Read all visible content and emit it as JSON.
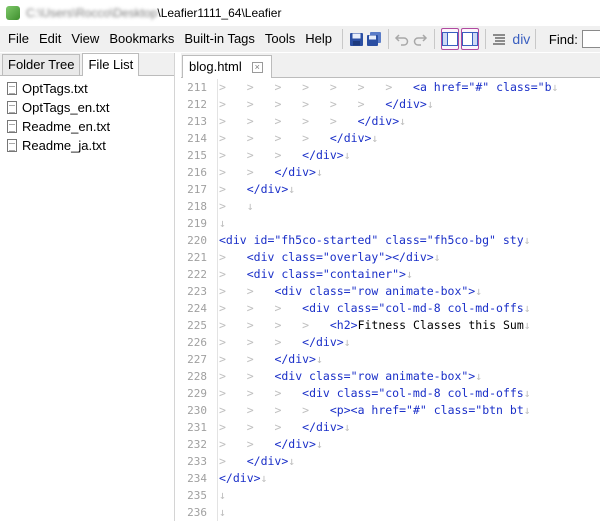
{
  "title": {
    "path_blurred": "C:\\Users\\Rocco\\Desktop",
    "path_suffix": "\\Leafier1111_64\\Leafier"
  },
  "menu": [
    "File",
    "Edit",
    "View",
    "Bookmarks",
    "Built-in Tags",
    "Tools",
    "Help"
  ],
  "toolbar": {
    "div_label": "div",
    "find_label": "Find:"
  },
  "left_panel": {
    "tabs": [
      "Folder Tree",
      "File List"
    ],
    "active_tab": "File List",
    "files": [
      "OptTags.txt",
      "OptTags_en.txt",
      "Readme_en.txt",
      "Readme_ja.txt"
    ]
  },
  "editor": {
    "tab_label": "blog.html",
    "lines": [
      {
        "n": "211",
        "indent": 7,
        "code": "<a href=\"#\" class=\"b"
      },
      {
        "n": "212",
        "indent": 6,
        "code": "</div>"
      },
      {
        "n": "213",
        "indent": 5,
        "code": "</div>"
      },
      {
        "n": "214",
        "indent": 4,
        "code": "</div>"
      },
      {
        "n": "215",
        "indent": 3,
        "code": "</div>"
      },
      {
        "n": "216",
        "indent": 2,
        "code": "</div>"
      },
      {
        "n": "217",
        "indent": 1,
        "code": "</div>"
      },
      {
        "n": "218",
        "indent": 1,
        "code": ""
      },
      {
        "n": "219",
        "indent": 0,
        "code": ""
      },
      {
        "n": "220",
        "indent": 0,
        "code": "<div id=\"fh5co-started\" class=\"fh5co-bg\" sty"
      },
      {
        "n": "221",
        "indent": 1,
        "code": "<div class=\"overlay\"></div>"
      },
      {
        "n": "222",
        "indent": 1,
        "code": "<div class=\"container\">"
      },
      {
        "n": "223",
        "indent": 2,
        "code": "<div class=\"row animate-box\">"
      },
      {
        "n": "224",
        "indent": 3,
        "code": "<div class=\"col-md-8 col-md-offs"
      },
      {
        "n": "225",
        "indent": 4,
        "code": "<h2>Fitness Classes this Sum"
      },
      {
        "n": "226",
        "indent": 3,
        "code": "</div>"
      },
      {
        "n": "227",
        "indent": 2,
        "code": "</div>"
      },
      {
        "n": "228",
        "indent": 2,
        "code": "<div class=\"row animate-box\">"
      },
      {
        "n": "229",
        "indent": 3,
        "code": "<div class=\"col-md-8 col-md-offs"
      },
      {
        "n": "230",
        "indent": 4,
        "code": "<p><a href=\"#\" class=\"btn bt"
      },
      {
        "n": "231",
        "indent": 3,
        "code": "</div>"
      },
      {
        "n": "232",
        "indent": 2,
        "code": "</div>"
      },
      {
        "n": "233",
        "indent": 1,
        "code": "</div>"
      },
      {
        "n": "234",
        "indent": 0,
        "code": "</div>"
      },
      {
        "n": "235",
        "indent": 0,
        "code": ""
      },
      {
        "n": "236",
        "indent": 0,
        "code": ""
      }
    ]
  }
}
